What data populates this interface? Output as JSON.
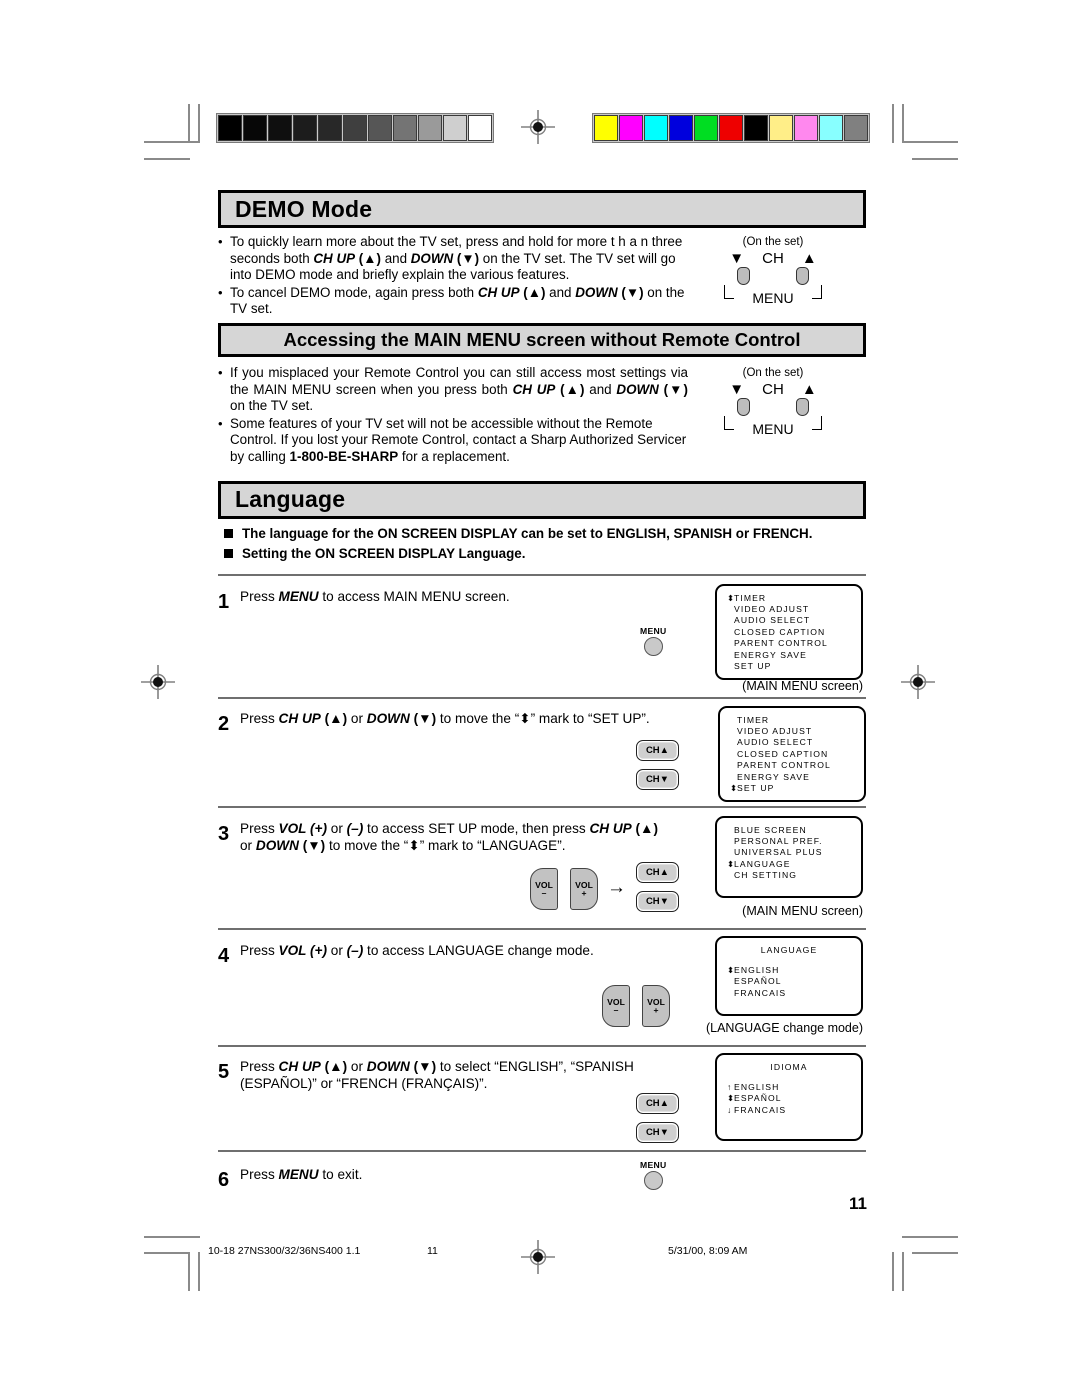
{
  "calibration": {
    "gray_swatches": [
      "#000000",
      "#070707",
      "#0f0f0f",
      "#1c1c1c",
      "#282828",
      "#3f3f3f",
      "#565656",
      "#747474",
      "#9a9a9a",
      "#cfcfcf",
      "#ffffff"
    ],
    "color_swatches": [
      "#ffff00",
      "#ff00ff",
      "#00ffff",
      "#0000dd",
      "#00dd22",
      "#ee0000",
      "#000000",
      "#ffee88",
      "#ff88ee",
      "#88ffff",
      "#808080"
    ]
  },
  "sections": {
    "demo": {
      "heading": "DEMO Mode",
      "bullets": [
        {
          "parts": [
            {
              "t": "To quickly learn more about the TV set, press and hold for more t h a n three seconds both ",
              "s": "n"
            },
            {
              "t": "CH UP",
              "s": "bi"
            },
            {
              "t": " (▲)",
              "s": "b"
            },
            {
              "t": " and ",
              "s": "n"
            },
            {
              "t": "DOWN",
              "s": "bi"
            },
            {
              "t": " (▼)",
              "s": "b"
            },
            {
              "t": "  on the TV set. The TV set will go into DEMO mode and briefly explain the various features.",
              "s": "n"
            }
          ]
        },
        {
          "parts": [
            {
              "t": "To cancel DEMO mode, again press both ",
              "s": "n"
            },
            {
              "t": "CH UP",
              "s": "bi"
            },
            {
              "t": " (▲)",
              "s": "b"
            },
            {
              "t": " and ",
              "s": "n"
            },
            {
              "t": "DOWN",
              "s": "bi"
            },
            {
              "t": " (▼)",
              "s": "b"
            },
            {
              "t": " on the TV set.",
              "s": "n"
            }
          ]
        }
      ],
      "diagram": {
        "caption": "(On the set)",
        "down_arrow": "▼",
        "ch_label": "CH",
        "up_arrow": "▲",
        "menu_label": "MENU"
      }
    },
    "mainmenu": {
      "heading": "Accessing the MAIN MENU screen without Remote Control",
      "bullets": [
        {
          "parts": [
            {
              "t": "If you misplaced your Remote Control you can still access most settings via the MAIN MENU screen when you press both ",
              "s": "n"
            },
            {
              "t": "CH UP",
              "s": "bi"
            },
            {
              "t": " (▲)",
              "s": "b"
            },
            {
              "t": " and ",
              "s": "n"
            },
            {
              "t": "DOWN",
              "s": "bi"
            },
            {
              "t": " (▼)",
              "s": "b"
            },
            {
              "t": "  on the TV set.",
              "s": "n"
            }
          ]
        },
        {
          "parts": [
            {
              "t": "Some features of your TV set will not be accessible without the Remote Control.  If you lost your Remote Control, contact a Sharp Authorized Servicer by calling ",
              "s": "n"
            },
            {
              "t": "1-800-BE-SHARP",
              "s": "b"
            },
            {
              "t": " for a replacement.",
              "s": "n"
            }
          ]
        }
      ],
      "diagram": {
        "caption": "(On the set)",
        "down_arrow": "▼",
        "ch_label": "CH",
        "up_arrow": "▲",
        "menu_label": "MENU"
      }
    },
    "language": {
      "heading": "Language",
      "notes": [
        "The language for the ON SCREEN DISPLAY can be set to ENGLISH, SPANISH or FRENCH.",
        "Setting the ON SCREEN DISPLAY Language."
      ]
    }
  },
  "steps": [
    {
      "num": "1",
      "text_parts": [
        {
          "t": "Press ",
          "s": "n"
        },
        {
          "t": "MENU",
          "s": "bi"
        },
        {
          "t": " to access MAIN MENU screen.",
          "s": "n"
        }
      ],
      "menu_key": "MENU",
      "osd": {
        "lines": [
          {
            "mark": "⬍",
            "label": "TIMER"
          },
          {
            "mark": "",
            "label": "VIDEO ADJUST"
          },
          {
            "mark": "",
            "label": "AUDIO SELECT"
          },
          {
            "mark": "",
            "label": "CLOSED CAPTION"
          },
          {
            "mark": "",
            "label": "PARENT CONTROL"
          },
          {
            "mark": "",
            "label": "ENERGY SAVE"
          },
          {
            "mark": "",
            "label": "SET UP"
          }
        ],
        "caption": "(MAIN MENU screen)"
      }
    },
    {
      "num": "2",
      "text_parts": [
        {
          "t": "Press ",
          "s": "n"
        },
        {
          "t": "CH UP",
          "s": "bi"
        },
        {
          "t": " (▲)",
          "s": "b"
        },
        {
          "t": " or ",
          "s": "n"
        },
        {
          "t": "DOWN",
          "s": "bi"
        },
        {
          "t": " (▼)",
          "s": "b"
        },
        {
          "t": " to move the “⬍” mark to “SET UP”.",
          "s": "n"
        }
      ],
      "ch_up_key": "CH▲",
      "ch_dn_key": "CH▼",
      "osd": {
        "lines": [
          {
            "mark": "",
            "label": "TIMER"
          },
          {
            "mark": "",
            "label": "VIDEO ADJUST"
          },
          {
            "mark": "",
            "label": "AUDIO SELECT"
          },
          {
            "mark": "",
            "label": "CLOSED CAPTION"
          },
          {
            "mark": "",
            "label": "PARENT CONTROL"
          },
          {
            "mark": "",
            "label": "ENERGY SAVE"
          },
          {
            "mark": "⬍",
            "label": "SET UP"
          }
        ],
        "caption": ""
      }
    },
    {
      "num": "3",
      "text_parts": [
        {
          "t": "Press  ",
          "s": "n"
        },
        {
          "t": "VOL",
          "s": "bi"
        },
        {
          "t": " (+)",
          "s": "bi"
        },
        {
          "t": " or ",
          "s": "n"
        },
        {
          "t": "(–)",
          "s": "bi"
        },
        {
          "t": " to access SET UP mode, then press ",
          "s": "n"
        },
        {
          "t": "CH UP",
          "s": "bi"
        },
        {
          "t": " (▲)",
          "s": "b"
        },
        {
          "t": " or ",
          "s": "n"
        },
        {
          "t": "DOWN",
          "s": "bi"
        },
        {
          "t": " (▼)",
          "s": "b"
        },
        {
          "t": " to move the “⬍” mark to “LANGUAGE”.",
          "s": "n"
        }
      ],
      "vol_minus": "VOL",
      "vol_minus_sign": "–",
      "vol_plus": "VOL",
      "vol_plus_sign": "+",
      "arrow": "→",
      "ch_up_key": "CH▲",
      "ch_dn_key": "CH▼",
      "osd": {
        "lines": [
          {
            "mark": "",
            "label": "BLUE SCREEN"
          },
          {
            "mark": "",
            "label": "PERSONAL PREF."
          },
          {
            "mark": "",
            "label": "UNIVERSAL PLUS"
          },
          {
            "mark": "⬍",
            "label": "LANGUAGE"
          },
          {
            "mark": "",
            "label": "CH SETTING"
          }
        ],
        "caption": "(MAIN MENU screen)"
      }
    },
    {
      "num": "4",
      "text_parts": [
        {
          "t": "Press ",
          "s": "n"
        },
        {
          "t": "VOL",
          "s": "bi"
        },
        {
          "t": " (+)",
          "s": "bi"
        },
        {
          "t": " or ",
          "s": "n"
        },
        {
          "t": "(–)",
          "s": "bi"
        },
        {
          "t": " to access LANGUAGE change mode.",
          "s": "n"
        }
      ],
      "vol_minus": "VOL",
      "vol_minus_sign": "–",
      "vol_plus": "VOL",
      "vol_plus_sign": "+",
      "osd": {
        "title": "LANGUAGE",
        "lines": [
          {
            "mark": "⬍",
            "label": "ENGLISH"
          },
          {
            "mark": "",
            "label": "ESPAÑOL"
          },
          {
            "mark": "",
            "label": "FRANCAIS"
          }
        ],
        "caption": "(LANGUAGE change mode)"
      }
    },
    {
      "num": "5",
      "text_parts": [
        {
          "t": "Press ",
          "s": "n"
        },
        {
          "t": "CH UP",
          "s": "bi"
        },
        {
          "t": " (▲)",
          "s": "b"
        },
        {
          "t": " or ",
          "s": "n"
        },
        {
          "t": "DOWN",
          "s": "bi"
        },
        {
          "t": " (▼)",
          "s": "b"
        },
        {
          "t": " to select “ENGLISH”, “SPANISH (ESPAÑOL)” or “FRENCH (FRANÇAIS)”.",
          "s": "n"
        }
      ],
      "ch_up_key": "CH▲",
      "ch_dn_key": "CH▼",
      "osd": {
        "title": "IDIOMA",
        "lines": [
          {
            "mark": "↑",
            "label": "ENGLISH"
          },
          {
            "mark": "⬍",
            "label": "ESPAÑOL"
          },
          {
            "mark": "↓",
            "label": "FRANCAIS"
          }
        ],
        "caption": ""
      }
    },
    {
      "num": "6",
      "text_parts": [
        {
          "t": "Press ",
          "s": "n"
        },
        {
          "t": "MENU",
          "s": "bi"
        },
        {
          "t": " to exit.",
          "s": "n"
        }
      ],
      "menu_key": "MENU"
    }
  ],
  "page_number": "11",
  "footer": {
    "doc_code": "10-18 27NS300/32/36NS400 1.1",
    "page": "11",
    "timestamp": "5/31/00, 8:09 AM"
  }
}
